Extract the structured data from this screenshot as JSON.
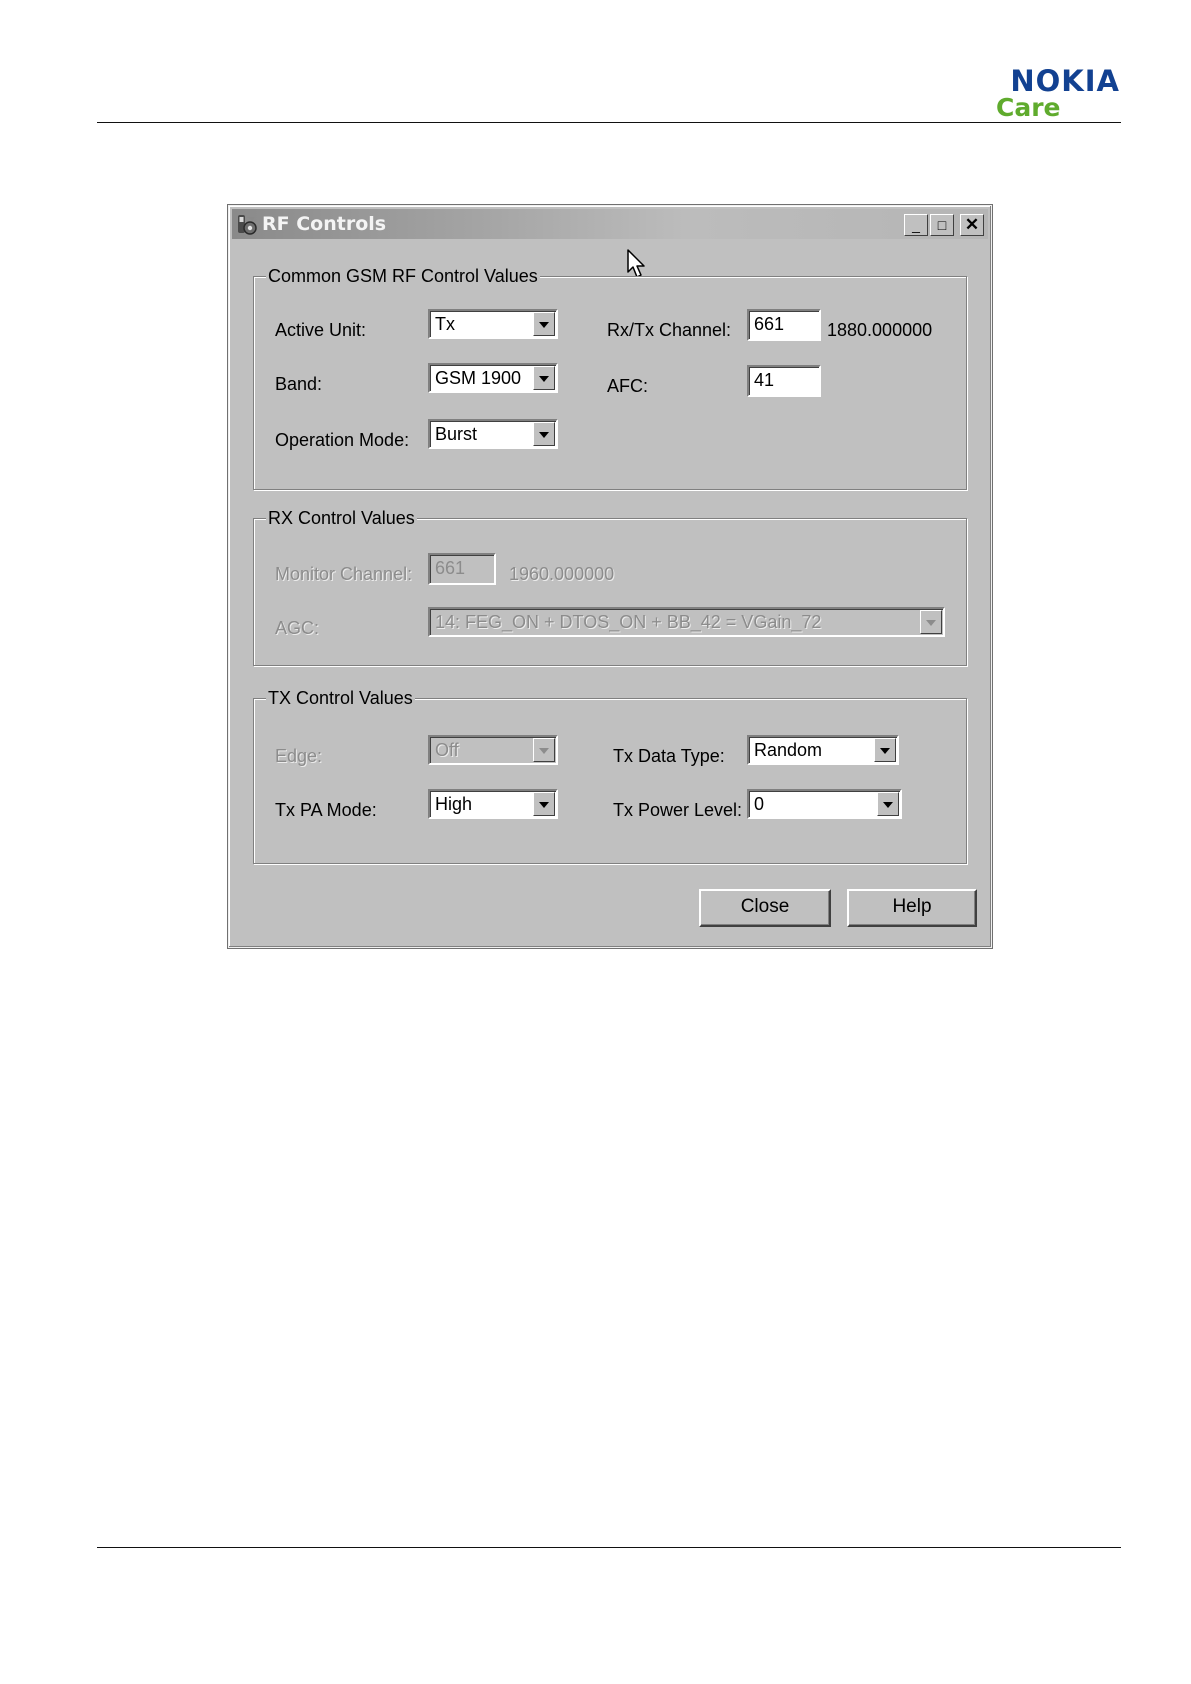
{
  "brand": {
    "name": "NOKIA",
    "sub": "Care"
  },
  "window": {
    "title": "RF Controls",
    "controls": {
      "minimize": "_",
      "maximize": "□",
      "close": "✕"
    }
  },
  "common": {
    "legend": "Common GSM RF Control Values",
    "active_unit_label": "Active Unit:",
    "active_unit_value": "Tx",
    "band_label": "Band:",
    "band_value": "GSM 1900",
    "operation_mode_label": "Operation Mode:",
    "operation_mode_value": "Burst",
    "rxtx_channel_label": "Rx/Tx Channel:",
    "rxtx_channel_value": "661",
    "rxtx_frequency": "1880.000000",
    "afc_label": "AFC:",
    "afc_value": "41"
  },
  "rx": {
    "legend": "RX Control Values",
    "monitor_channel_label": "Monitor Channel:",
    "monitor_channel_value": "661",
    "monitor_frequency": "1960.000000",
    "agc_label": "AGC:",
    "agc_value": "14: FEG_ON + DTOS_ON + BB_42 = VGain_72"
  },
  "tx": {
    "legend": "TX Control Values",
    "edge_label": "Edge:",
    "edge_value": "Off",
    "pa_mode_label": "Tx PA Mode:",
    "pa_mode_value": "High",
    "data_type_label": "Tx Data Type:",
    "data_type_value": "Random",
    "power_level_label": "Tx Power Level:",
    "power_level_value": "0"
  },
  "buttons": {
    "close": "Close",
    "help": "Help"
  },
  "icons": {
    "app": "phone-tool-icon",
    "cursor": "mouse-pointer-icon"
  }
}
